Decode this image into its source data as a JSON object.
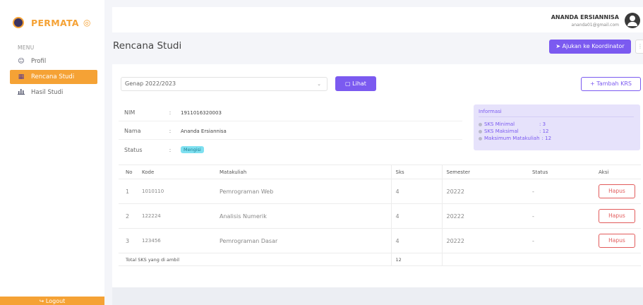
{
  "brand": {
    "name": "PERMATA",
    "toggle_icon": "circle-target-icon"
  },
  "sidebar": {
    "menu_title": "MENU",
    "items": [
      {
        "label": "Profil",
        "icon": "user-icon",
        "active": false
      },
      {
        "label": "Rencana Studi",
        "icon": "book-icon",
        "active": true
      },
      {
        "label": "Hasil Studi",
        "icon": "bar-chart-icon",
        "active": false
      }
    ],
    "logout_label": "↪ Logout"
  },
  "topbar": {
    "user_name": "ANANDA ERSIANNISA",
    "user_email": "ananda01@gmail.com"
  },
  "page": {
    "title": "Rencana Studi",
    "ajukan_label": "Ajukan ke Koordinator",
    "more_label": "⋮"
  },
  "filter": {
    "semester_value": "Genap 2022/2023",
    "lihat_label": "Lihat",
    "tambah_label": "Tambah KRS"
  },
  "student": {
    "nim_label": "NIM",
    "nim_value": "1911016320003",
    "nama_label": "Nama",
    "nama_value": "Ananda Ersiannisa",
    "status_label": "Status",
    "status_value": "Mengisi",
    "sep": ":"
  },
  "informasi": {
    "title": "Informasi",
    "items": [
      {
        "key": "SKS Minimal",
        "value": ": 3"
      },
      {
        "key": "SKS Maksimal",
        "value": ": 12"
      },
      {
        "key": "Maksimum Matakuliah",
        "value": ": 12"
      }
    ]
  },
  "table": {
    "headers": [
      "No",
      "Kode",
      "Matakuliah",
      "Sks",
      "Semester",
      "Status",
      "Aksi"
    ],
    "rows": [
      {
        "no": "1",
        "kode": "1010110",
        "matakuliah": "Pemrograman Web",
        "sks": "4",
        "semester": "20222",
        "status": "-",
        "aksi": "Hapus"
      },
      {
        "no": "2",
        "kode": "122224",
        "matakuliah": "Analisis Numerik",
        "sks": "4",
        "semester": "20222",
        "status": "-",
        "aksi": "Hapus"
      },
      {
        "no": "3",
        "kode": "123456",
        "matakuliah": "Pemrograman Dasar",
        "sks": "4",
        "semester": "20222",
        "status": "-",
        "aksi": "Hapus"
      }
    ],
    "total_label": "Total SKS yang di ambil",
    "total_value": "12"
  },
  "colors": {
    "accent_orange": "#f5a235",
    "accent_purple": "#7b5af0",
    "danger": "#e25b5b"
  }
}
